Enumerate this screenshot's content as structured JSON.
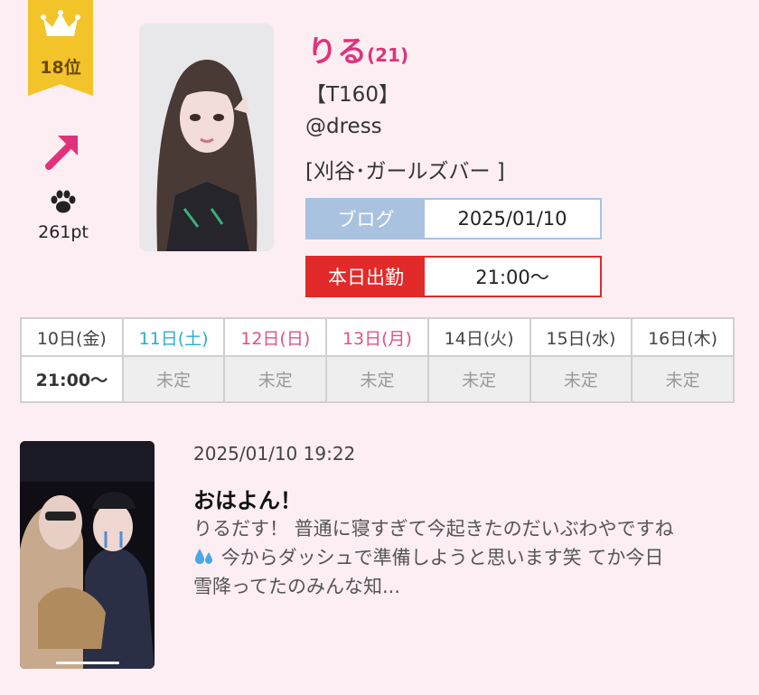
{
  "rank": {
    "label": "18位",
    "icon": "crown-icon",
    "trend_icon": "arrow-up-right-icon"
  },
  "points": {
    "icon": "paw-icon",
    "value": "261pt"
  },
  "profile": {
    "name": "りる",
    "age": "(21)",
    "height": "【T160】",
    "shop": "@dress",
    "area": "[刈谷･ガールズバー ]"
  },
  "blog_tag": {
    "label": "ブログ",
    "value": "2025/01/10"
  },
  "shift_tag": {
    "label": "本日出勤",
    "value": "21:00〜"
  },
  "schedule": {
    "days": [
      {
        "label": "10日(金)",
        "color": "#444444"
      },
      {
        "label": "11日(土)",
        "color": "#2aaecb"
      },
      {
        "label": "12日(日)",
        "color": "#e0508a"
      },
      {
        "label": "13日(月)",
        "color": "#e0508a"
      },
      {
        "label": "14日(火)",
        "color": "#444444"
      },
      {
        "label": "15日(水)",
        "color": "#444444"
      },
      {
        "label": "16日(木)",
        "color": "#444444"
      }
    ],
    "times": [
      "21:00〜",
      "未定",
      "未定",
      "未定",
      "未定",
      "未定",
      "未定"
    ]
  },
  "post": {
    "date": "2025/01/10 19:22",
    "title": "おはよん！",
    "excerpt_1": "りるだす！ 普通に寝すぎて今起きたのだいぶわやですね",
    "excerpt_2": "今からダッシュで準備しようと思います笑 てか今日",
    "excerpt_3": "雪降ってたのみんな知...",
    "emoji_icon": "sweat-droplets-icon"
  },
  "colors": {
    "accent": "#e0327a",
    "gold": "#f3c32a",
    "blog": "#a9c2e0",
    "shift": "#e22a2a",
    "background": "#fdeef3"
  }
}
